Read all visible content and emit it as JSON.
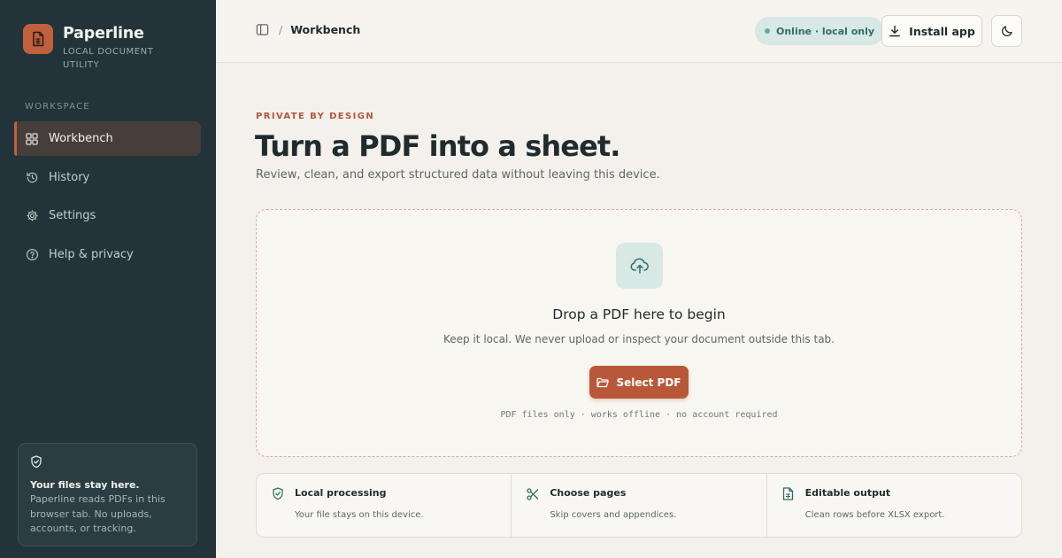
{
  "app": {
    "name": "Paperline",
    "tagline": "LOCAL DOCUMENT UTILITY"
  },
  "sidebar": {
    "section_label": "WORKSPACE",
    "items": [
      {
        "label": "Workbench",
        "icon": "grid-icon",
        "active": true
      },
      {
        "label": "History",
        "icon": "history-icon",
        "active": false
      },
      {
        "label": "Settings",
        "icon": "gear-icon",
        "active": false
      },
      {
        "label": "Help & privacy",
        "icon": "help-circle-icon",
        "active": false
      }
    ],
    "privacy_card": {
      "icon": "shield-check-icon",
      "title": "Your files stay here.",
      "text": "Paperline reads PDFs in this browser tab. No uploads, accounts, or tracking."
    }
  },
  "topbar": {
    "breadcrumb_separator": "/",
    "breadcrumb_current": "Workbench",
    "status": "Online · local only",
    "install_label": "Install app",
    "theme_icon": "moon-icon"
  },
  "hero": {
    "eyebrow": "PRIVATE BY DESIGN",
    "title": "Turn a PDF into a sheet.",
    "subtitle": "Review, clean, and export structured data without leaving this device."
  },
  "dropzone": {
    "title": "Drop a PDF here to begin",
    "subtitle": "Keep it local. We never upload or inspect your document outside this tab.",
    "button_label": "Select PDF",
    "note": "PDF files only · works offline · no account required"
  },
  "features": [
    {
      "icon": "shield-check-icon",
      "title": "Local processing",
      "desc": "Your file stays on this device."
    },
    {
      "icon": "scissors-icon",
      "title": "Choose pages",
      "desc": "Skip covers and appendices."
    },
    {
      "icon": "spreadsheet-icon",
      "title": "Editable output",
      "desc": "Clean rows before XLSX export."
    }
  ],
  "colors": {
    "sidebar_bg": "#22343a",
    "accent": "#b95838",
    "status_bg": "#d7e8e5",
    "page_bg": "#f4f1ec"
  }
}
